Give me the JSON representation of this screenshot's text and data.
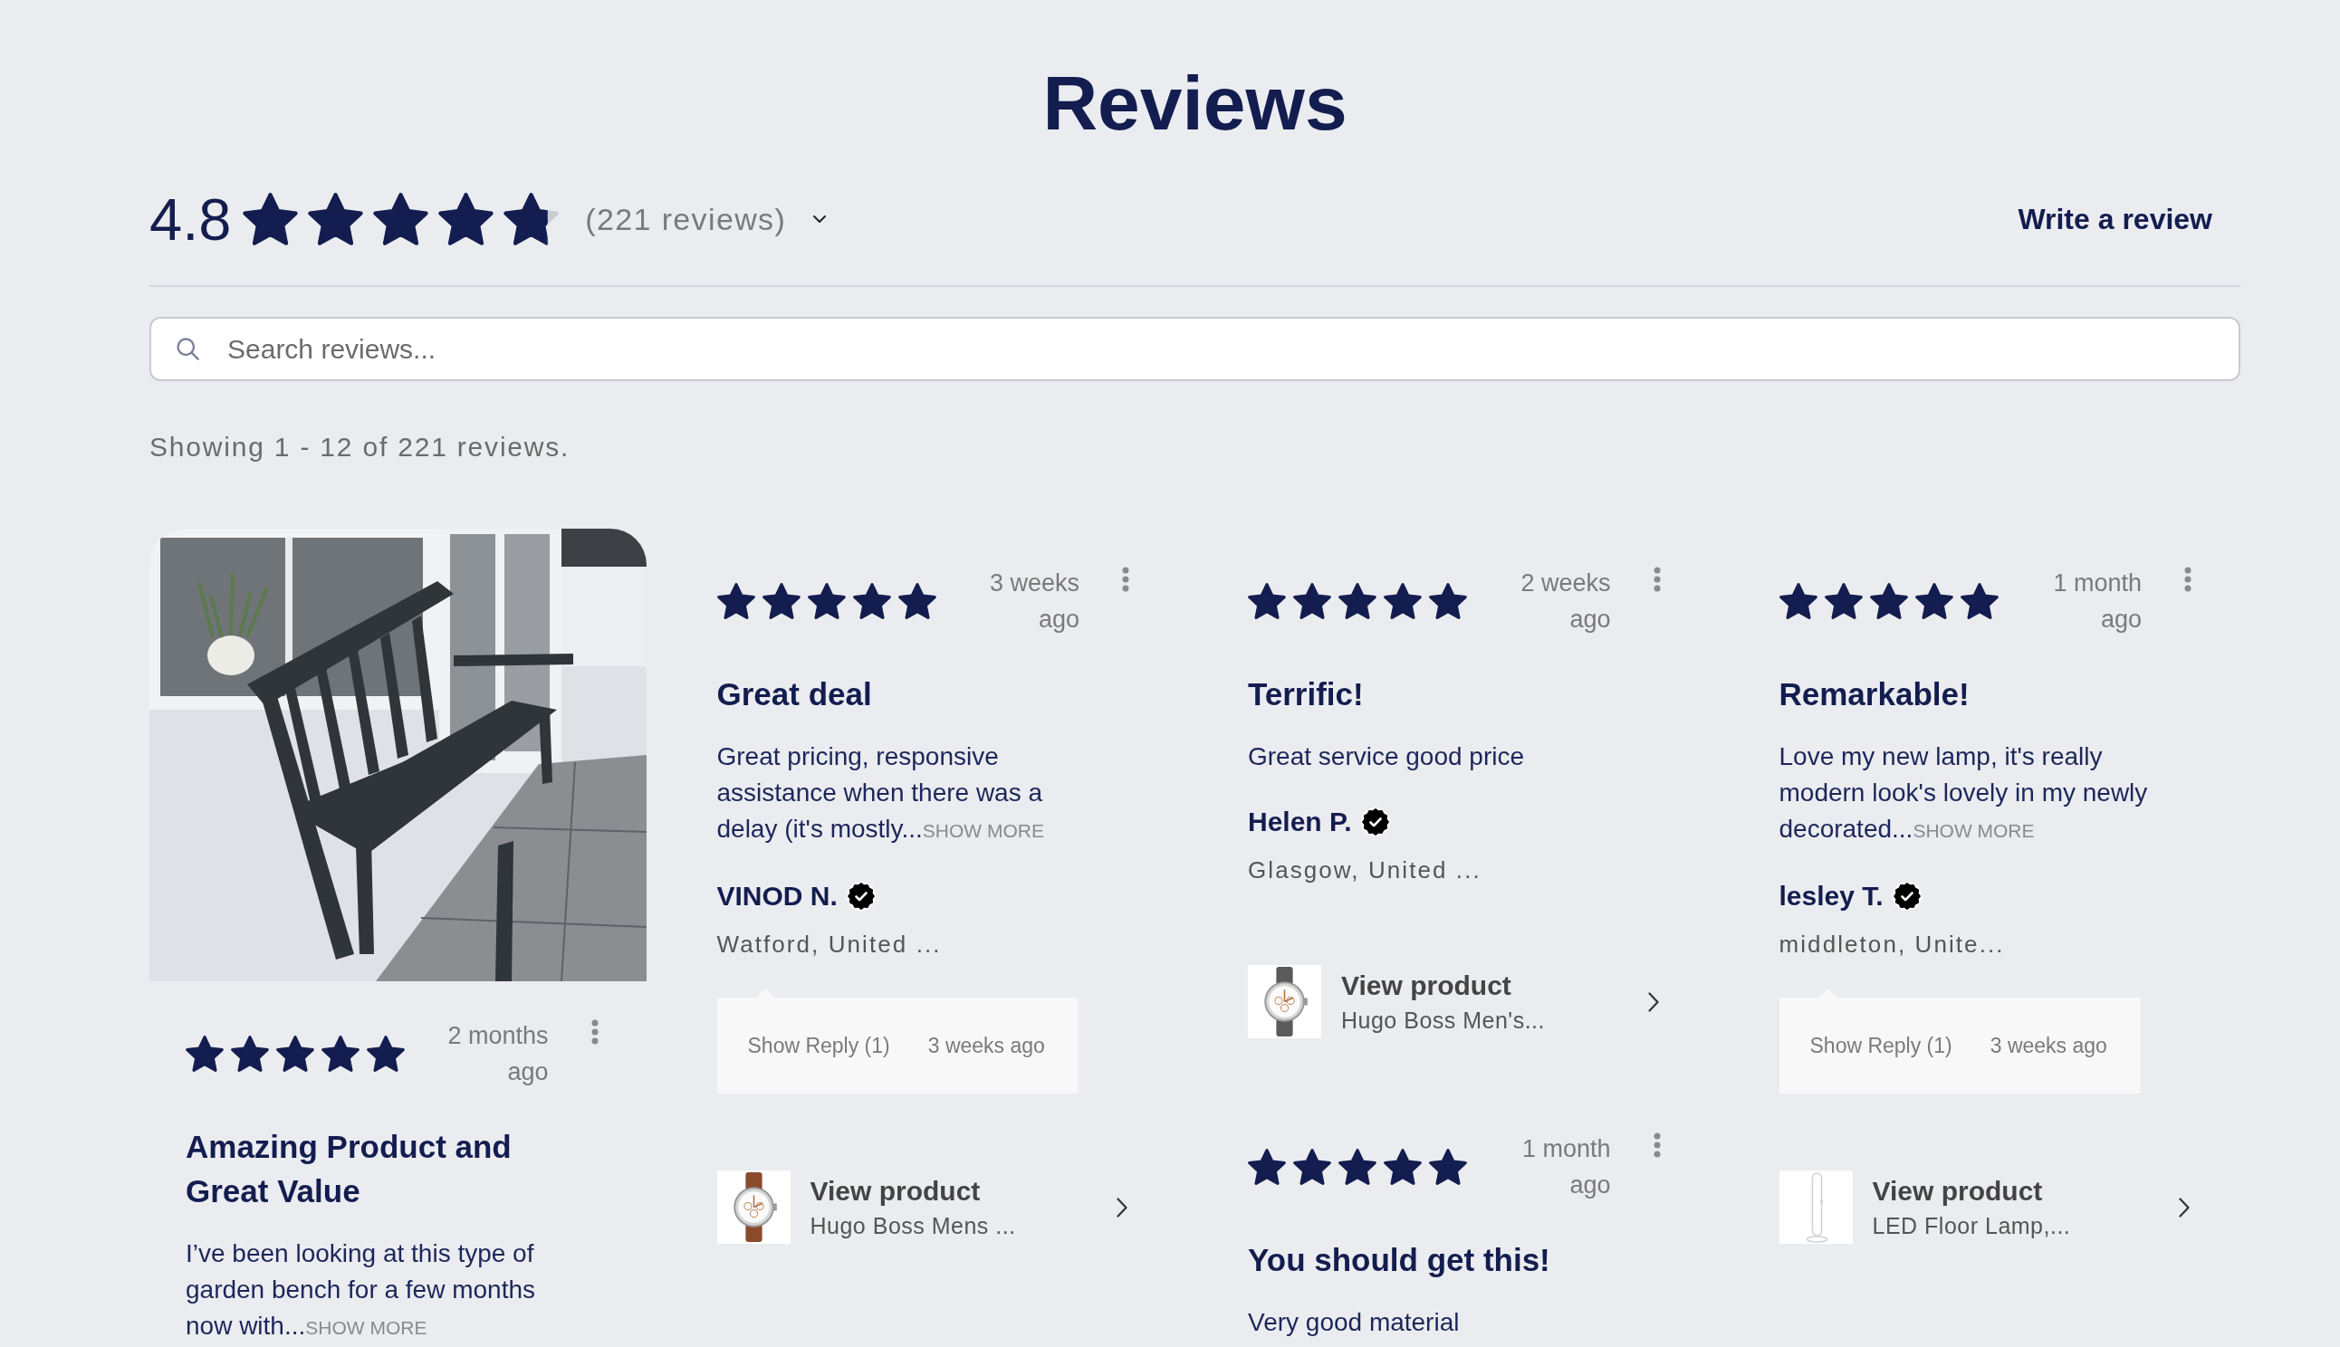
{
  "title": "Reviews",
  "summary": {
    "rating": "4.8",
    "stars": 4.8,
    "count": "(221 reviews)",
    "write_review": "Write a review"
  },
  "search": {
    "placeholder": "Search reviews..."
  },
  "showing": "Showing 1 - 12 of 221 reviews.",
  "columns": [
    {
      "reviews": [
        {
          "photo": true,
          "stars": 5,
          "time": "2 months ago",
          "title": "Amazing Product and Great Value",
          "text": "I’ve been looking at this type of garden bench for a few months now with...",
          "more": "SHOW MORE"
        }
      ]
    },
    {
      "reviews": [
        {
          "stars": 5,
          "time": "3 weeks ago",
          "title": "Great deal",
          "text": "Great pricing, responsive assistance when there was a delay (it's mostly...",
          "more": "SHOW MORE",
          "author": "VINOD N.",
          "verified": true,
          "location": "Watford, United ...",
          "reply": {
            "label": "Show Reply (1)",
            "time": "3 weeks ago"
          },
          "product": {
            "label": "View product",
            "name": "Hugo Boss Mens ...",
            "kind": "watch",
            "color": "#8a4b2c"
          }
        }
      ]
    },
    {
      "reviews": [
        {
          "stars": 5,
          "time": "2 weeks ago",
          "title": "Terrific!",
          "text": "Great service good price",
          "author": "Helen P.",
          "verified": true,
          "location": "Glasgow, United ...",
          "product": {
            "label": "View product",
            "name": "Hugo Boss Men's...",
            "kind": "watch",
            "color": "#5a5a5a"
          }
        },
        {
          "stars": 5,
          "time": "1 month ago",
          "title": "You should get this!",
          "text": "Very good material"
        }
      ]
    },
    {
      "reviews": [
        {
          "stars": 5,
          "time": "1 month ago",
          "title": "Remarkable!",
          "text": "Love my new lamp, it's really modern look's lovely in my newly decorated...",
          "more": "SHOW MORE",
          "author": "lesley T.",
          "verified": true,
          "location": "middleton, Unite...",
          "reply": {
            "label": "Show Reply (1)",
            "time": "3 weeks ago"
          },
          "product": {
            "label": "View product",
            "name": "LED Floor Lamp,...",
            "kind": "lamp"
          }
        }
      ]
    }
  ]
}
